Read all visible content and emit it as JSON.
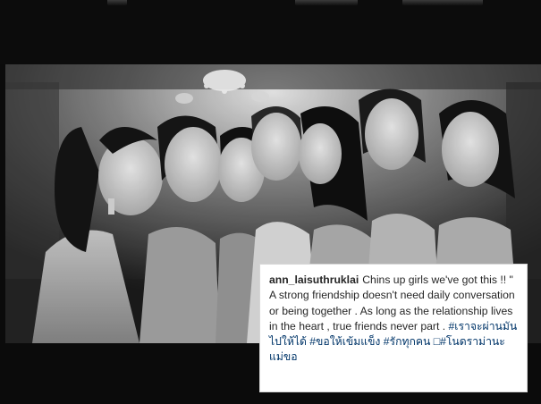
{
  "post": {
    "photo_description_icon": "group-photo",
    "photo_palette": "black-and-white"
  },
  "caption": {
    "username": "ann_laisuthruklai",
    "text": "Chins up girls we've got this !! \" A strong friendship doesn't need daily conversation or being together . As long as the relationship lives in the heart , true friends never part . ",
    "hashtags": "#เราจะผ่านมันไปให้ได้ #ขอให้เข้มแข็ง #รักทุกคน □#โนดราม่านะแม่ขอ"
  },
  "colors": {
    "caption_background": "#ffffff",
    "caption_text": "#262626",
    "hashtag": "#003569",
    "backdrop": "#0b0b0b"
  }
}
